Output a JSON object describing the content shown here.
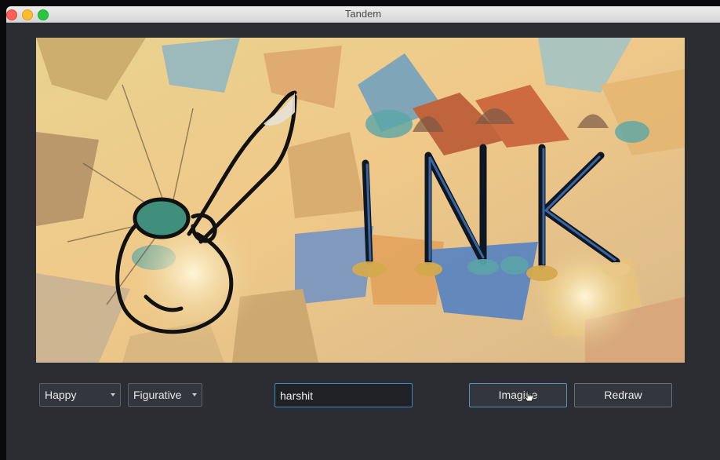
{
  "window": {
    "title": "Tandem"
  },
  "canvas": {
    "drawn_text": "INK"
  },
  "controls": {
    "mood_select": {
      "selected": "Happy"
    },
    "style_select": {
      "selected": "Figurative"
    },
    "name_input": {
      "value": "harshit"
    },
    "imagine_label": "Imagine",
    "redraw_label": "Redraw"
  },
  "colors": {
    "window_bg": "#2b2d33",
    "focus_blue": "#3d89c7",
    "traffic_close": "#fc5f57",
    "traffic_min": "#fdbc2e",
    "traffic_max": "#28c840"
  },
  "icons": [
    "close-light",
    "minimize-light",
    "maximize-light",
    "chevron-down-icon",
    "pointer-cursor-icon"
  ]
}
